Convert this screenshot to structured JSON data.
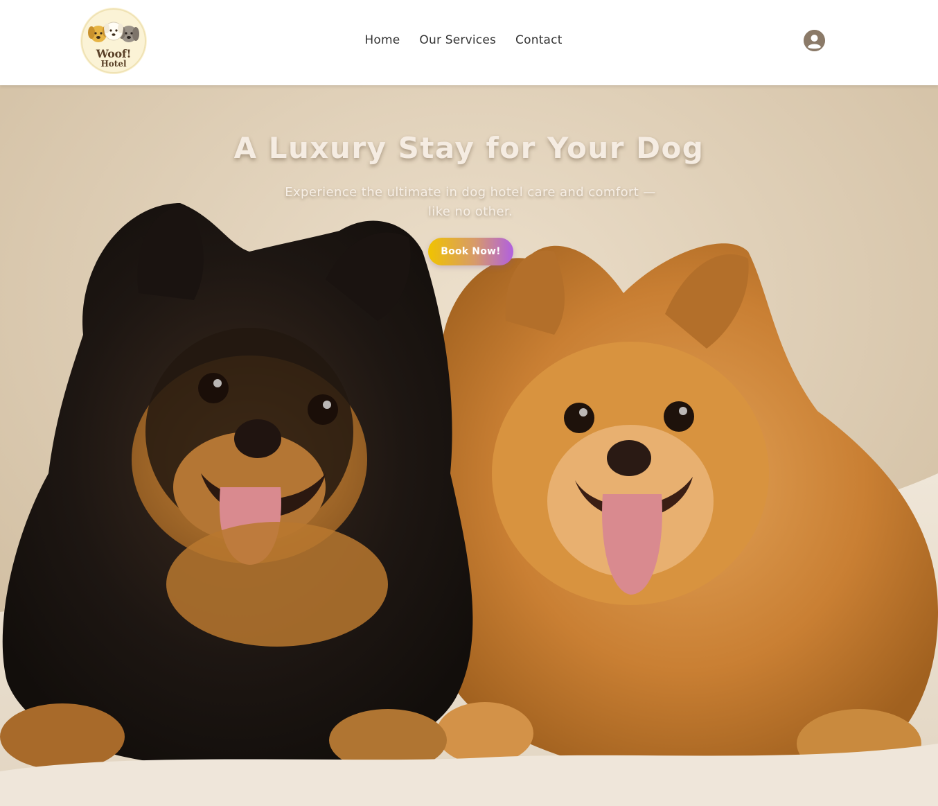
{
  "header": {
    "logo": {
      "line1": "Woof!",
      "line2": "Hotel"
    },
    "nav": [
      {
        "label": "Home"
      },
      {
        "label": "Our Services"
      },
      {
        "label": "Contact"
      }
    ],
    "user_icon": "user-circle-icon"
  },
  "hero": {
    "title": "A Luxury Stay for Your Dog",
    "subtitle": "Experience the ultimate in dog hotel care and comfort — like no other.",
    "cta_label": "Book Now!",
    "image": "two-pomeranian-dogs-photo"
  },
  "colors": {
    "cta_gradient_start": "#f0c300",
    "cta_gradient_end": "#b060e0",
    "logo_bg": "#fbf3d6",
    "user_icon": "#8b7a68",
    "hero_bg": "#d9c8ae"
  }
}
